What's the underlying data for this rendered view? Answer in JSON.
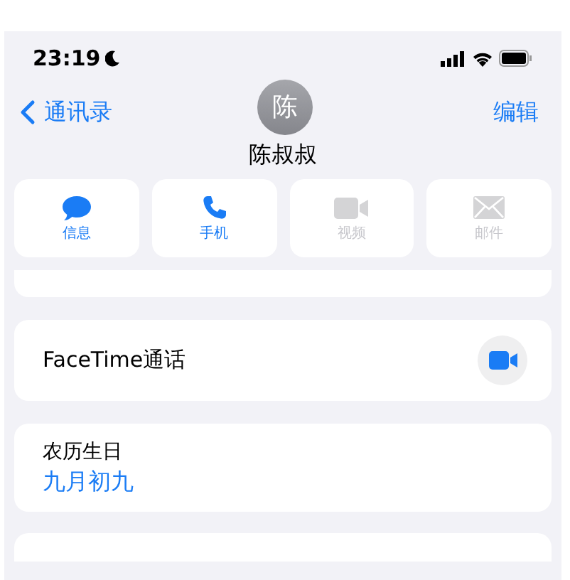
{
  "status_bar": {
    "time": "23:19"
  },
  "nav": {
    "back": "通讯录",
    "avatar": "陈",
    "name": "陈叔叔",
    "edit": "编辑"
  },
  "actions": [
    {
      "kind": "message",
      "label": "信息",
      "disabled": false
    },
    {
      "kind": "phone",
      "label": "手机",
      "disabled": false
    },
    {
      "kind": "video",
      "label": "视频",
      "disabled": true
    },
    {
      "kind": "mail",
      "label": "邮件",
      "disabled": true
    }
  ],
  "facetime": {
    "label": "FaceTime通话"
  },
  "lunar_birthday": {
    "label": "农历生日",
    "value": "九月初九"
  }
}
